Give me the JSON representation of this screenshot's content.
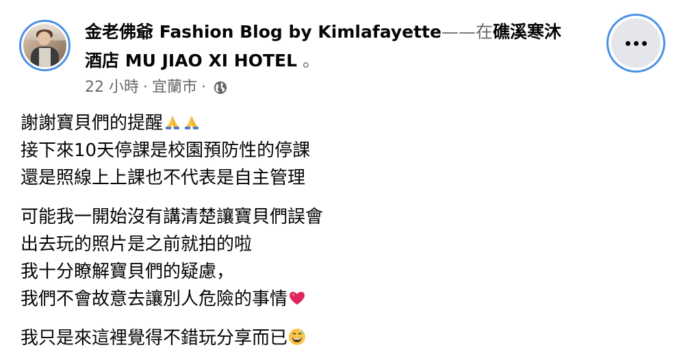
{
  "post": {
    "author": "金老佛爺 Fashion Blog by Kimlafayette",
    "connector": "——在",
    "location_line1": "礁溪寒沐",
    "location_line2": "酒店 MU JIAO XI HOTEL",
    "location_suffix": " 。",
    "time": "22 小時",
    "separator": "·",
    "place": "宜蘭市",
    "separator2": "·",
    "audience_icon": "globe-icon",
    "more_icon": "more-options-icon",
    "paragraphs": [
      [
        "謝謝寶貝們的提醒",
        "接下來10天停課是校園預防性的停課",
        "還是照線上上課也不代表是自主管理"
      ],
      [
        "可能我一開始沒有講清楚讓寶貝們誤會",
        "出去玩的照片是之前就拍的啦",
        "我十分瞭解寶貝們的疑慮，",
        "我們不會故意去讓別人危險的事情"
      ],
      [
        "我只是來這裡覺得不錯玩分享而已"
      ]
    ],
    "emojis": {
      "pray": "folded-hands-emoji",
      "heart": "red-heart-emoji",
      "sweat": "grinning-sweat-emoji"
    }
  },
  "colors": {
    "focus_ring": "#4a90e2",
    "secondary_text": "#65676b",
    "primary_text": "#050505",
    "button_bg": "#e4e6eb",
    "heart": "#e0245e",
    "emoji_yellow": "#f7c64a"
  }
}
